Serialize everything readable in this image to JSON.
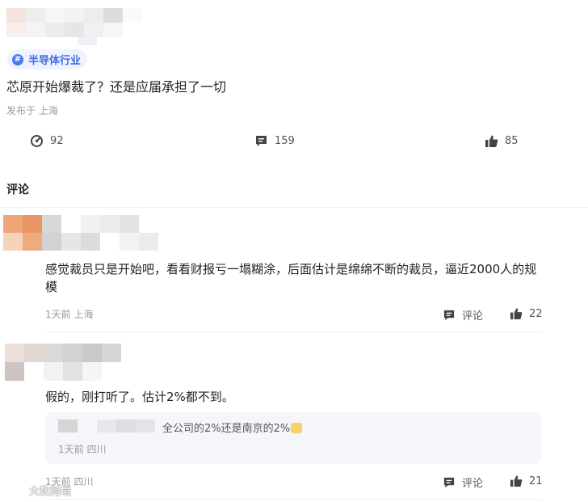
{
  "post": {
    "topic_tag": "半导体行业",
    "title": "芯原开始爆裁了？还是应届承担了一切",
    "meta": "发布于 上海",
    "stats": {
      "views": "92",
      "comments": "159",
      "likes": "85"
    }
  },
  "comments_section": {
    "title": "评论"
  },
  "comments": [
    {
      "text": "感觉裁员只是开始吧，看看财报亏一塌糊涂，后面估计是绵绵不断的裁员，逼近2000人的规模",
      "meta": "1天前 上海",
      "reply_label": "评论",
      "likes": "22"
    },
    {
      "text": "假的，刚打听了。估计2%都不到。",
      "reply": {
        "text": "全公司的2%还是南京的2%",
        "meta": "1天前 四川"
      },
      "meta": "1天前 四川",
      "reply_label": "评论",
      "likes": "21"
    }
  ],
  "watermark": "大数跨境",
  "colors": {
    "accent": "#3d6fe5",
    "tag_bg": "#eef3ff",
    "muted": "#9a9a9a"
  }
}
